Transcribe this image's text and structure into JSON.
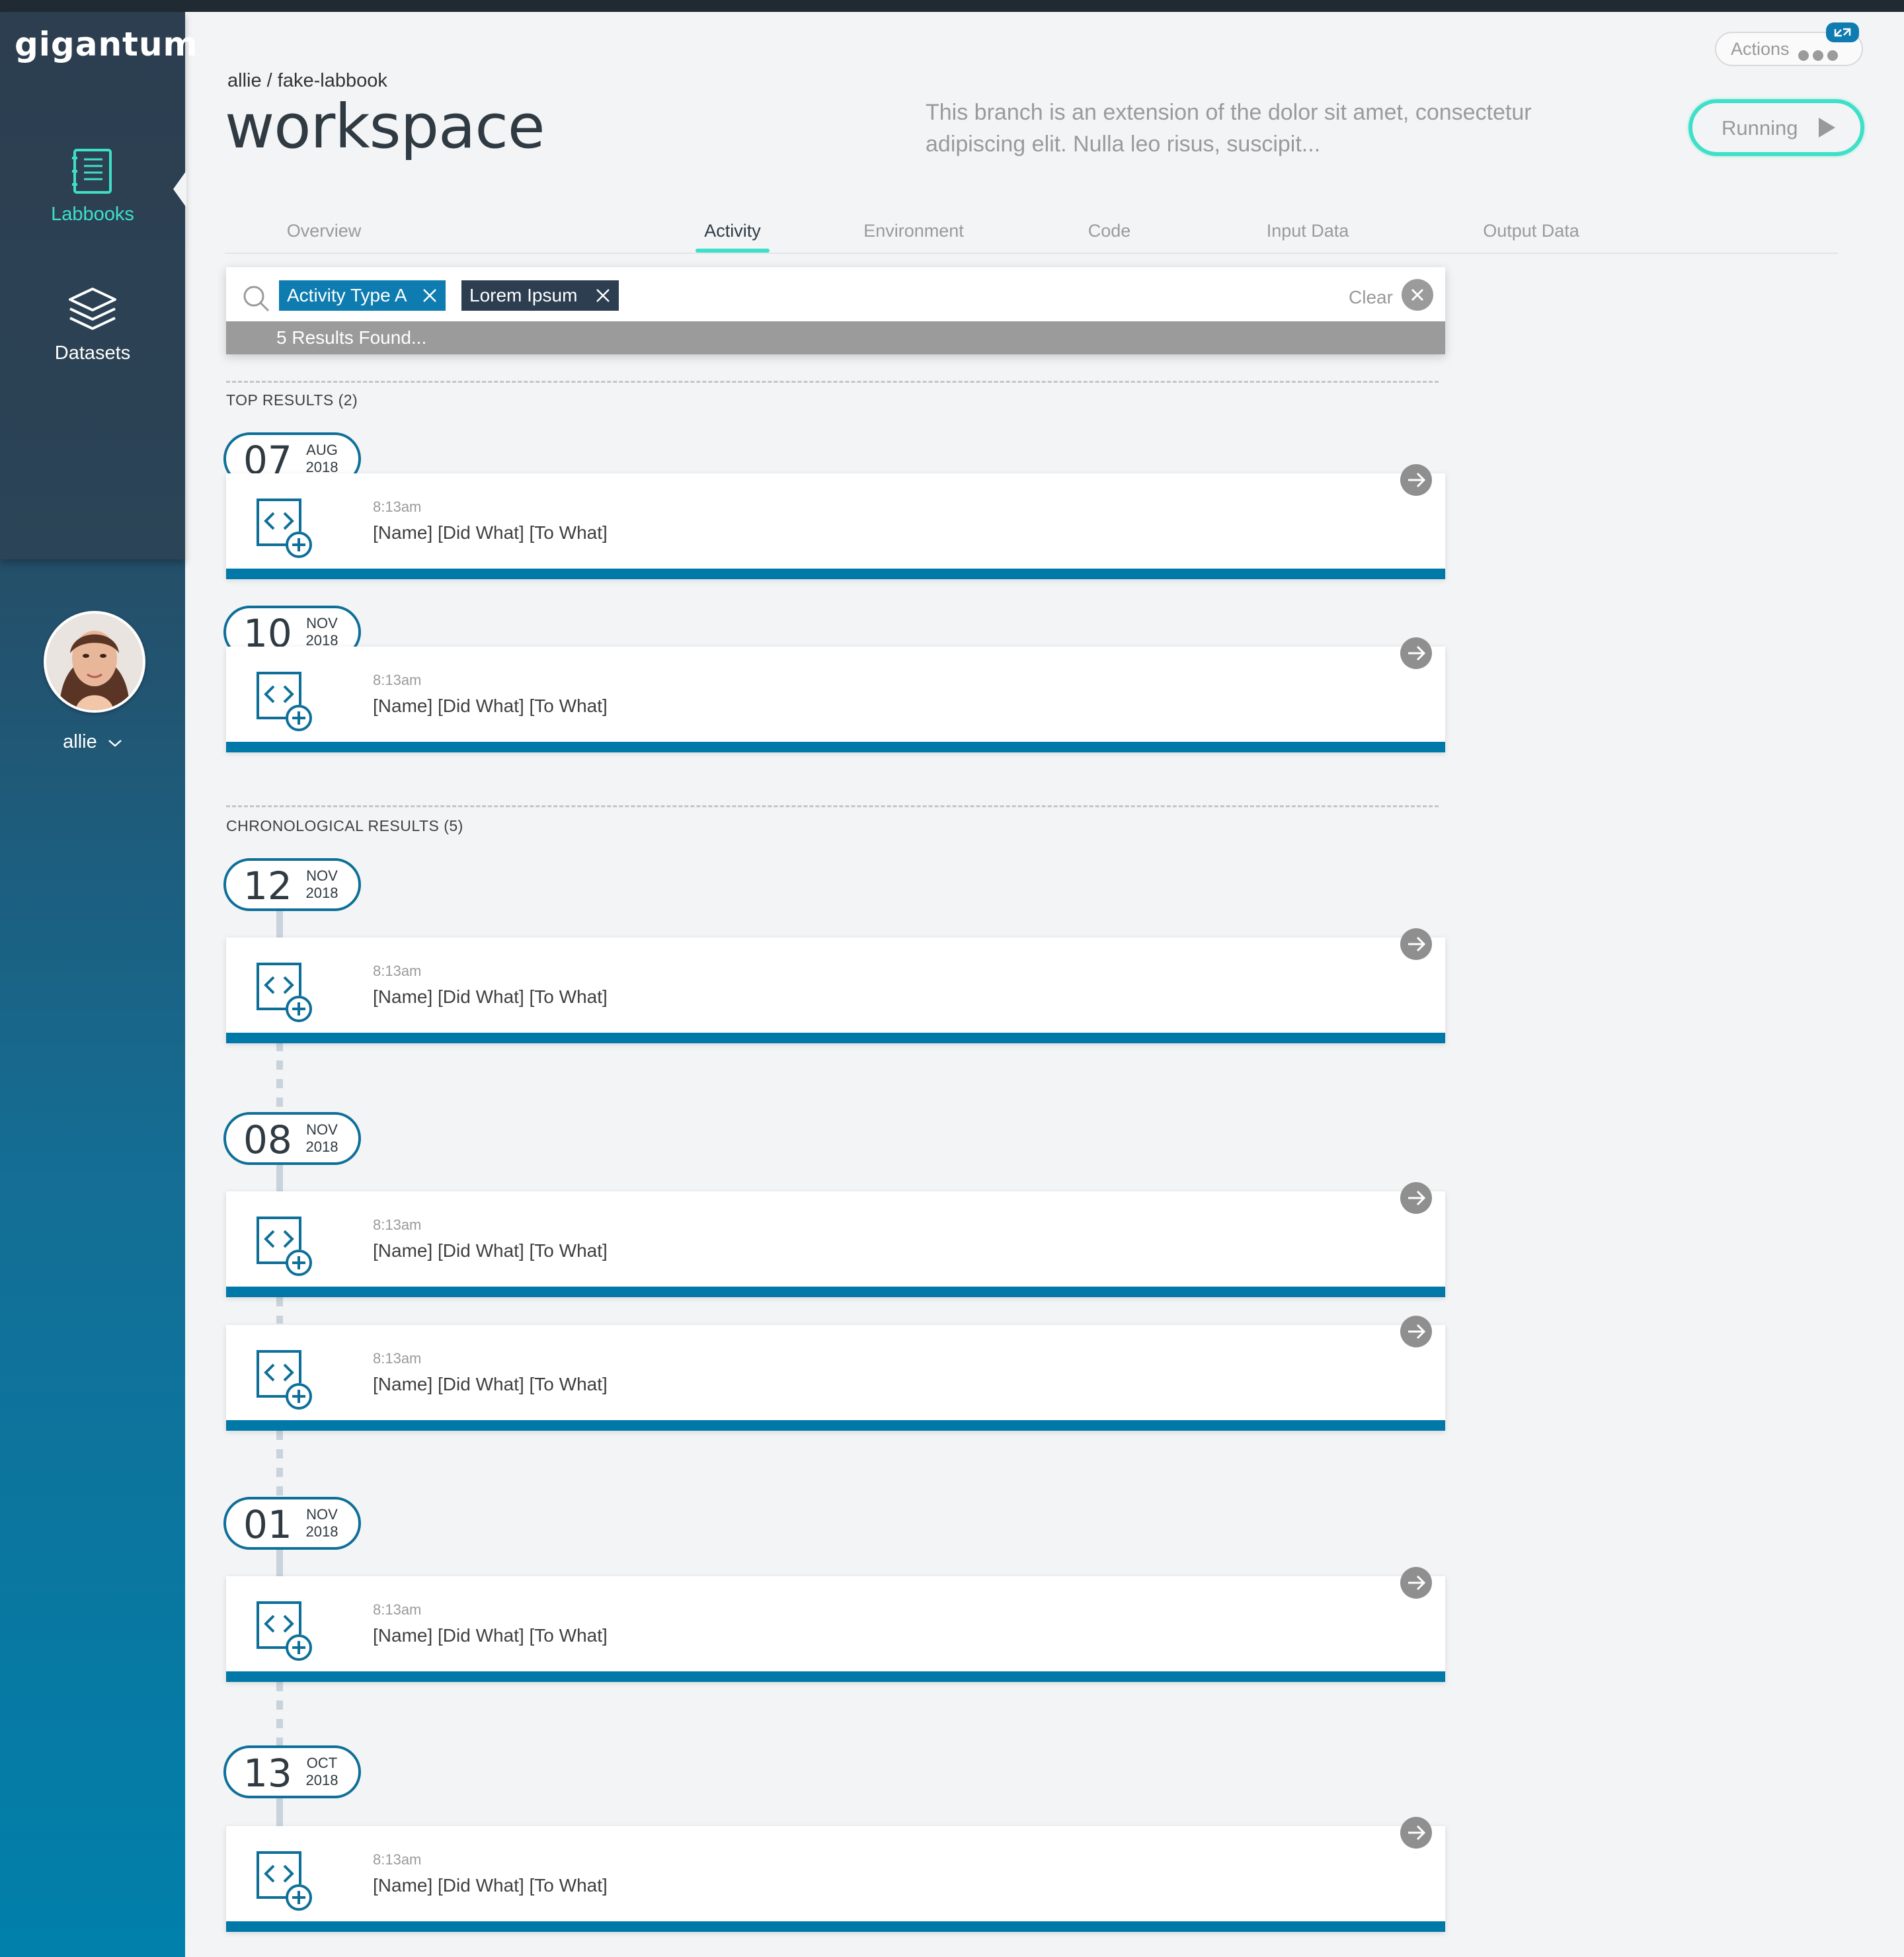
{
  "sidebar": {
    "logo": "gigantum",
    "nav": [
      {
        "label": "Labbooks",
        "icon": "labbook-icon",
        "active": true
      },
      {
        "label": "Datasets",
        "icon": "datasets-icon",
        "active": false
      }
    ],
    "user": {
      "name": "allie"
    }
  },
  "header": {
    "owner": "allie",
    "separator": "/",
    "labbook": "fake-labbook",
    "title": "workspace",
    "description": "This branch is an extension of the dolor sit amet, consectetur adipiscing elit. Nulla leo risus, suscipit...",
    "actions_label": "Actions",
    "status_label": "Running"
  },
  "tabs": [
    "Overview",
    "Activity",
    "Environment",
    "Code",
    "Input Data",
    "Output Data"
  ],
  "active_tab": "Activity",
  "search": {
    "filters": [
      "Activity Type A",
      "Lorem Ipsum"
    ],
    "clear_label": "Clear",
    "results_text": "5 Results Found..."
  },
  "top_results": {
    "title": "TOP RESULTS (2)",
    "items": [
      {
        "day": "07",
        "month": "AUG",
        "year": "2018",
        "time": "8:13am",
        "text": "[Name] [Did What] [To What]"
      },
      {
        "day": "10",
        "month": "NOV",
        "year": "2018",
        "time": "8:13am",
        "text": "[Name] [Did What] [To What]"
      }
    ]
  },
  "chronological": {
    "title": "CHRONOLOGICAL RESULTS (5)",
    "dates": [
      {
        "day": "12",
        "month": "NOV",
        "year": "2018"
      },
      {
        "day": "08",
        "month": "NOV",
        "year": "2018"
      },
      {
        "day": "01",
        "month": "NOV",
        "year": "2018"
      },
      {
        "day": "13",
        "month": "OCT",
        "year": "2018"
      }
    ],
    "items": [
      {
        "time": "8:13am",
        "text": "[Name] [Did What] [To What]"
      },
      {
        "time": "8:13am",
        "text": "[Name] [Did What] [To What]"
      },
      {
        "time": "8:13am",
        "text": "[Name] [Did What] [To What]"
      },
      {
        "time": "8:13am",
        "text": "[Name] [Did What] [To What]"
      },
      {
        "time": "8:13am",
        "text": "[Name] [Did What] [To What]"
      }
    ]
  },
  "colors": {
    "accent": "#3fe0c8",
    "primary": "#0e7cb0",
    "dark": "#2c3e50",
    "card_bar": "#0078a8"
  }
}
